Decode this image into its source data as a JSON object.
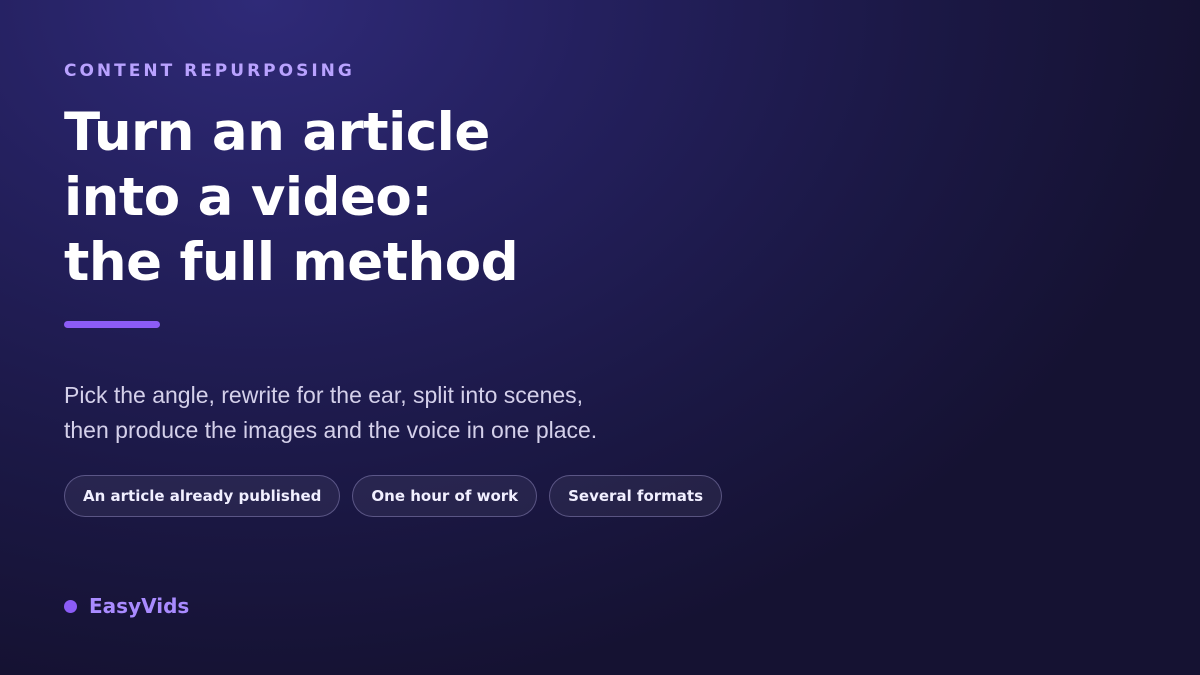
{
  "eyebrow": "CONTENT REPURPOSING",
  "title": {
    "line1": "Turn an article",
    "line2": "into a video:",
    "line3": "the full method"
  },
  "subtitle": {
    "line1": "Pick the angle, rewrite for the ear, split into scenes,",
    "line2": "then produce the images and the voice in one place."
  },
  "pills": [
    "An article already published",
    "One hour of work",
    "Several formats"
  ],
  "brand": {
    "name": "EasyVids"
  },
  "colors": {
    "accent": "#8b5cf6",
    "eyebrow": "#b9a2ff",
    "brand_text": "#a98bff",
    "background_dark": "#151232",
    "background_light": "#2f2a78"
  }
}
